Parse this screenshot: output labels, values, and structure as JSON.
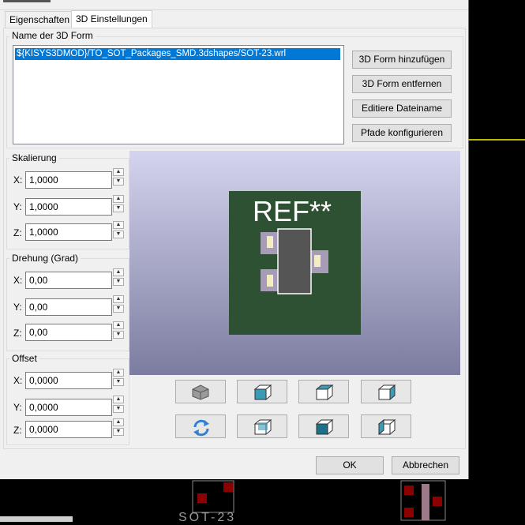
{
  "tabs": [
    {
      "label": "Eigenschaften"
    },
    {
      "label": "3D Einstellungen"
    }
  ],
  "shape_group": {
    "title": "Name der 3D Form",
    "files": [
      "${KISYS3DMOD}/TO_SOT_Packages_SMD.3dshapes/SOT-23.wrl"
    ]
  },
  "buttons": {
    "add": "3D Form hinzufügen",
    "remove": "3D Form entfernen",
    "edit": "Editiere Dateiname",
    "paths": "Pfade konfigurieren",
    "ok": "OK",
    "cancel": "Abbrechen"
  },
  "scale": {
    "title": "Skalierung",
    "x_label": "X:",
    "y_label": "Y:",
    "z_label": "Z:",
    "x": "1,0000",
    "y": "1,0000",
    "z": "1,0000"
  },
  "rotation": {
    "title": "Drehung (Grad)",
    "x_label": "X:",
    "y_label": "Y:",
    "z_label": "Z:",
    "x": "0,00",
    "y": "0,00",
    "z": "0,00"
  },
  "offset": {
    "title": "Offset",
    "x_label": "X:",
    "y_label": "Y:",
    "z_label": "Z:",
    "x": "0,0000",
    "y": "0,0000",
    "z": "0,0000"
  },
  "preview": {
    "ref_text": "REF**"
  },
  "view_buttons": [
    "cube-view-icon",
    "view-front-icon",
    "view-top-icon",
    "view-right-icon",
    "reload-icon",
    "view-back-icon",
    "view-bottom-icon",
    "view-left-icon"
  ],
  "colors": {
    "accent": "#0078d7",
    "board": "#2e5033",
    "viewport_top": "#d4d4ee",
    "viewport_bottom": "#7c7ca0"
  },
  "background_text": "SOT-23"
}
